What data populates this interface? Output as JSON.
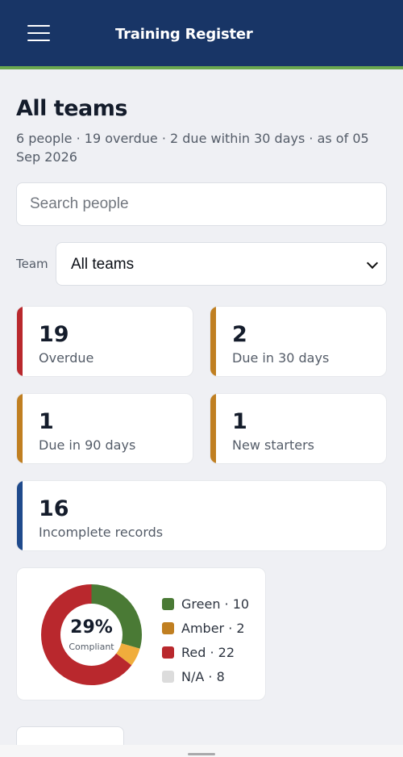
{
  "header": {
    "title": "Training Register",
    "menu_icon": "hamburger-menu-icon"
  },
  "page": {
    "title": "All teams",
    "subtitle": "6 people · 19 overdue · 2 due within 30 days · as of 05 Sep 2026"
  },
  "search": {
    "placeholder": "Search people",
    "value": ""
  },
  "filter": {
    "label": "Team",
    "selected": "All teams"
  },
  "colors": {
    "header_bg": "#183566",
    "accent_line": "#6aa84f",
    "overdue": "#b9282d",
    "due": "#c07f21",
    "incomplete": "#1f4a8c",
    "green": "#4a7a35",
    "amber": "#c07f21",
    "amber_slice": "#f0ad3c",
    "red": "#b9282d",
    "na": "#dcdcdc"
  },
  "stats": [
    {
      "value": "19",
      "label": "Overdue",
      "color": "#b9282d"
    },
    {
      "value": "2",
      "label": "Due in 30 days",
      "color": "#c07f21"
    },
    {
      "value": "1",
      "label": "Due in 90 days",
      "color": "#c07f21"
    },
    {
      "value": "1",
      "label": "New starters",
      "color": "#c07f21"
    },
    {
      "value": "16",
      "label": "Incomplete records",
      "color": "#1f4a8c"
    }
  ],
  "compliance": {
    "percent_label": "29%",
    "sub_label": "Compliant",
    "legend": [
      {
        "label": "Green · 10",
        "color": "#4a7a35"
      },
      {
        "label": "Amber · 2",
        "color": "#c07f21"
      },
      {
        "label": "Red · 22",
        "color": "#b9282d"
      },
      {
        "label": "N/A · 8",
        "color": "#dcdcdc"
      }
    ]
  },
  "chart_data": {
    "type": "pie",
    "categories": [
      "Green",
      "Amber",
      "Red"
    ],
    "values": [
      10,
      2,
      22
    ],
    "colors": [
      "#4a7a35",
      "#f0ad3c",
      "#b9282d"
    ],
    "title": "",
    "center_label": "29%",
    "center_sublabel": "Compliant"
  }
}
